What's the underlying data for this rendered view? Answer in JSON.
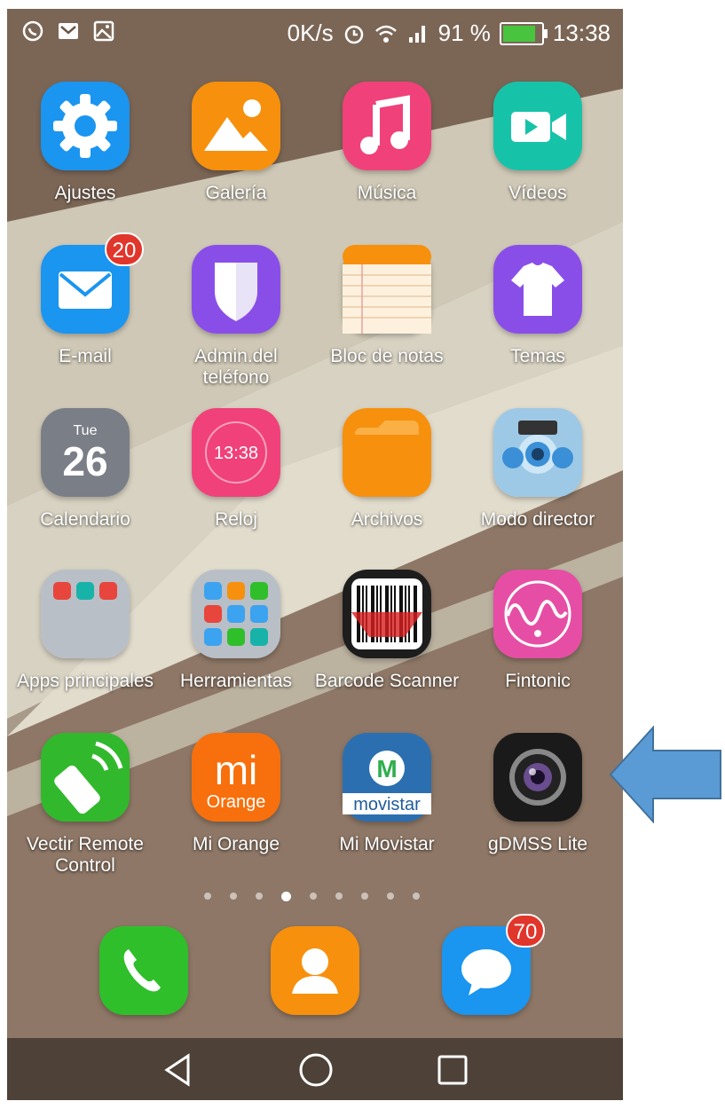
{
  "status_bar": {
    "net_speed": "0K/s",
    "battery": "91 %",
    "battery_level": 0.91,
    "time": "13:38",
    "icons": [
      "whatsapp-icon",
      "gmail-icon",
      "gallery-notification-icon",
      "alarm-icon",
      "wifi-icon",
      "signal-icon",
      "battery-charging-icon"
    ]
  },
  "apps": [
    {
      "label": "Ajustes",
      "icon": "settings-gear-icon",
      "color": "#1a95f0"
    },
    {
      "label": "Galería",
      "icon": "gallery-icon",
      "color": "#f7900d"
    },
    {
      "label": "Música",
      "icon": "music-note-icon",
      "color": "#f0417a"
    },
    {
      "label": "Vídeos",
      "icon": "video-camera-icon",
      "color": "#17c3a8"
    },
    {
      "label": "E-mail",
      "icon": "envelope-icon",
      "color": "#1a95f0",
      "badge": "20"
    },
    {
      "label": "Admin.del\nteléfono",
      "icon": "shield-icon",
      "color": "#8a4ee8"
    },
    {
      "label": "Bloc de notas",
      "icon": "notepad-icon",
      "color": "#f7900d"
    },
    {
      "label": "Temas",
      "icon": "tshirt-icon",
      "color": "#8a4ee8"
    },
    {
      "label": "Calendario",
      "icon": "calendar-icon",
      "color": "#7a7e86",
      "day": "Tue",
      "date": "26"
    },
    {
      "label": "Reloj",
      "icon": "clock-icon",
      "color": "#f0417a",
      "time": "13:38"
    },
    {
      "label": "Archivos",
      "icon": "folder-icon",
      "color": "#f7900d"
    },
    {
      "label": "Modo director",
      "icon": "director-mode-icon",
      "color": "#9ec9e6"
    },
    {
      "label": "Apps principales",
      "icon": "folder-apps-icon",
      "color": "#b9bfc6"
    },
    {
      "label": "Herramientas",
      "icon": "folder-tools-icon",
      "color": "#b9bfc6"
    },
    {
      "label": "Barcode Scanner",
      "icon": "barcode-icon",
      "color": "#1d1d1d"
    },
    {
      "label": "Fintonic",
      "icon": "fintonic-icon",
      "color": "#e64ea5"
    },
    {
      "label": "Vectir Remote\nControl",
      "icon": "remote-control-icon",
      "color": "#32b82d"
    },
    {
      "label": "Mi Orange",
      "icon": "mi-orange-icon",
      "color": "#f7700d",
      "text1": "mi",
      "text2": "Orange"
    },
    {
      "label": "Mi Movistar",
      "icon": "movistar-icon",
      "color": "#2c6fb0",
      "text1": "movistar"
    },
    {
      "label": "gDMSS Lite",
      "icon": "camera-lens-icon",
      "color": "#1a1a1a"
    }
  ],
  "page_indicator": {
    "count": 9,
    "active": 4
  },
  "dock": [
    {
      "name": "phone",
      "icon": "phone-icon",
      "color": "#2fbf2b"
    },
    {
      "name": "contacts",
      "icon": "contacts-icon",
      "color": "#f7900d"
    },
    {
      "name": "messages",
      "icon": "message-icon",
      "color": "#1a95f0",
      "badge": "70"
    }
  ],
  "nav": [
    "back-icon",
    "home-icon",
    "recents-icon"
  ],
  "annotation": {
    "color": "#5b9bd5"
  }
}
